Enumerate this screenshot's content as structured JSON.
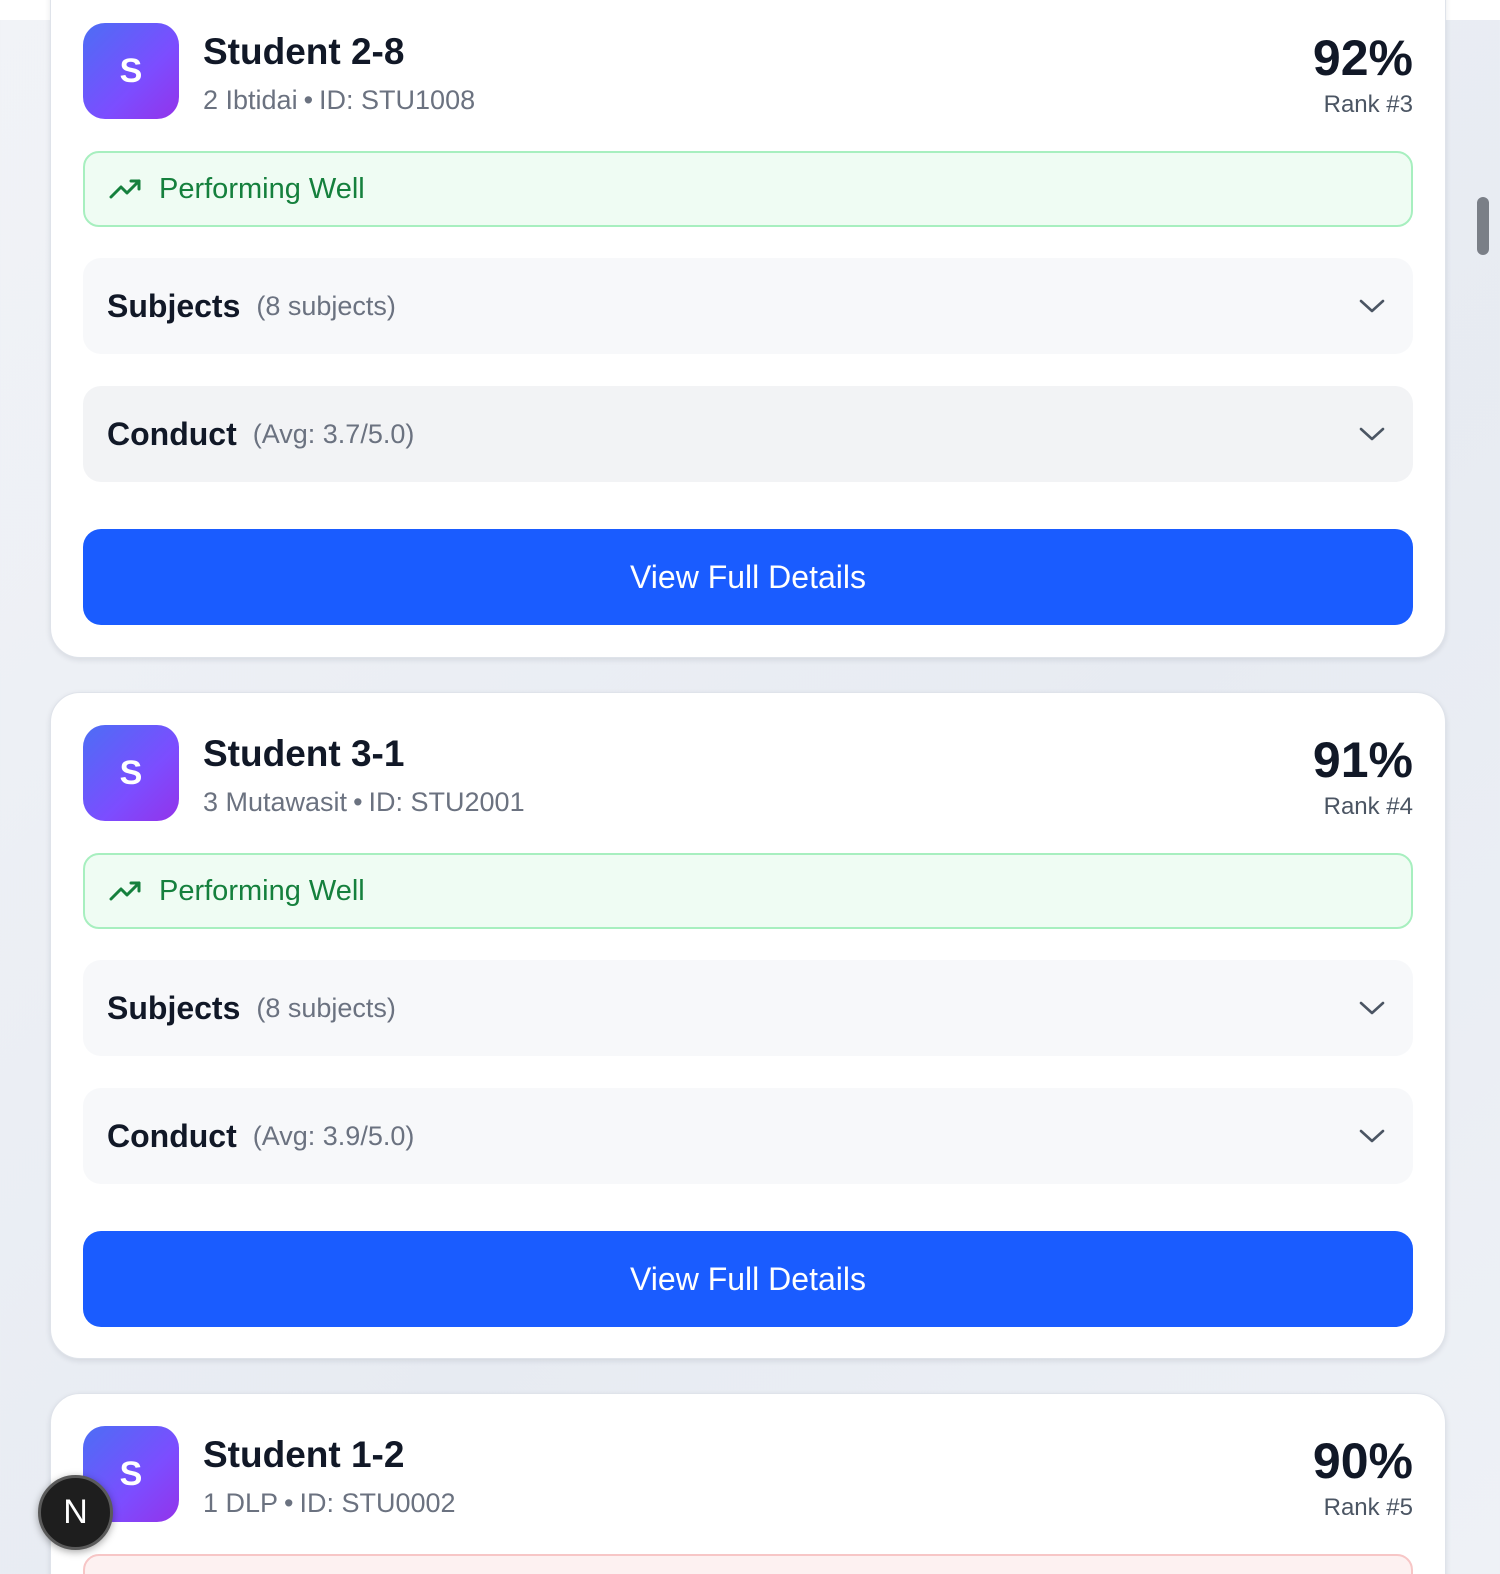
{
  "students": [
    {
      "avatar_letter": "S",
      "name": "Student 2-8",
      "class_name": "2 Ibtidai",
      "id_text": "ID: STU1008",
      "percent": "92%",
      "rank": "Rank #3",
      "status": "Performing Well",
      "subjects_label": "Subjects",
      "subjects_count": "(8 subjects)",
      "conduct_label": "Conduct",
      "conduct_avg": "(Avg: 3.7/5.0)",
      "button_label": "View Full Details"
    },
    {
      "avatar_letter": "S",
      "name": "Student 3-1",
      "class_name": "3 Mutawasit",
      "id_text": "ID: STU2001",
      "percent": "91%",
      "rank": "Rank #4",
      "status": "Performing Well",
      "subjects_label": "Subjects",
      "subjects_count": "(8 subjects)",
      "conduct_label": "Conduct",
      "conduct_avg": "(Avg: 3.9/5.0)",
      "button_label": "View Full Details"
    },
    {
      "avatar_letter": "S",
      "name": "Student 1-2",
      "class_name": "1 DLP",
      "id_text": "ID: STU0002",
      "percent": "90%",
      "rank": "Rank #5"
    }
  ],
  "separator": "•",
  "fab_letter": "N",
  "colors": {
    "primary_button": "#1a5cff",
    "status_good_text": "#15803d",
    "status_good_bg": "#effcf3",
    "avatar_gradient_start": "#4c6ef5",
    "avatar_gradient_end": "#9333ea"
  },
  "icons": {
    "status": "trending-up-icon",
    "expand": "chevron-down-icon"
  }
}
